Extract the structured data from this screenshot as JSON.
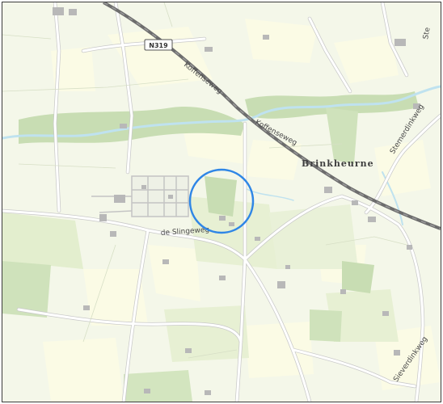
{
  "map": {
    "route_shield": "N319",
    "place_labels": {
      "village": "Brinkheurne"
    },
    "road_labels": {
      "koffenseweg_1": "Koffenseweg",
      "koffenseweg_2": "Koffenseweg",
      "slingeweg": "de Slingeweg",
      "stemerdinkweg": "Stemerdinkweg",
      "sieverdinkweg": "Sieverdinkweg",
      "top_right_partial": "Ste"
    },
    "colors": {
      "background": "#f4f7e9",
      "meadow": "#e7f0d3",
      "field_pale": "#fbfbe5",
      "forest": "#c8ddb3",
      "water": "#bfe2ef",
      "road": "#ffffff",
      "road_casing": "#c9c9c9",
      "railway": "#6d6d6d",
      "building": "#b8b8b8",
      "highlight_circle": "#2f86e6"
    }
  }
}
